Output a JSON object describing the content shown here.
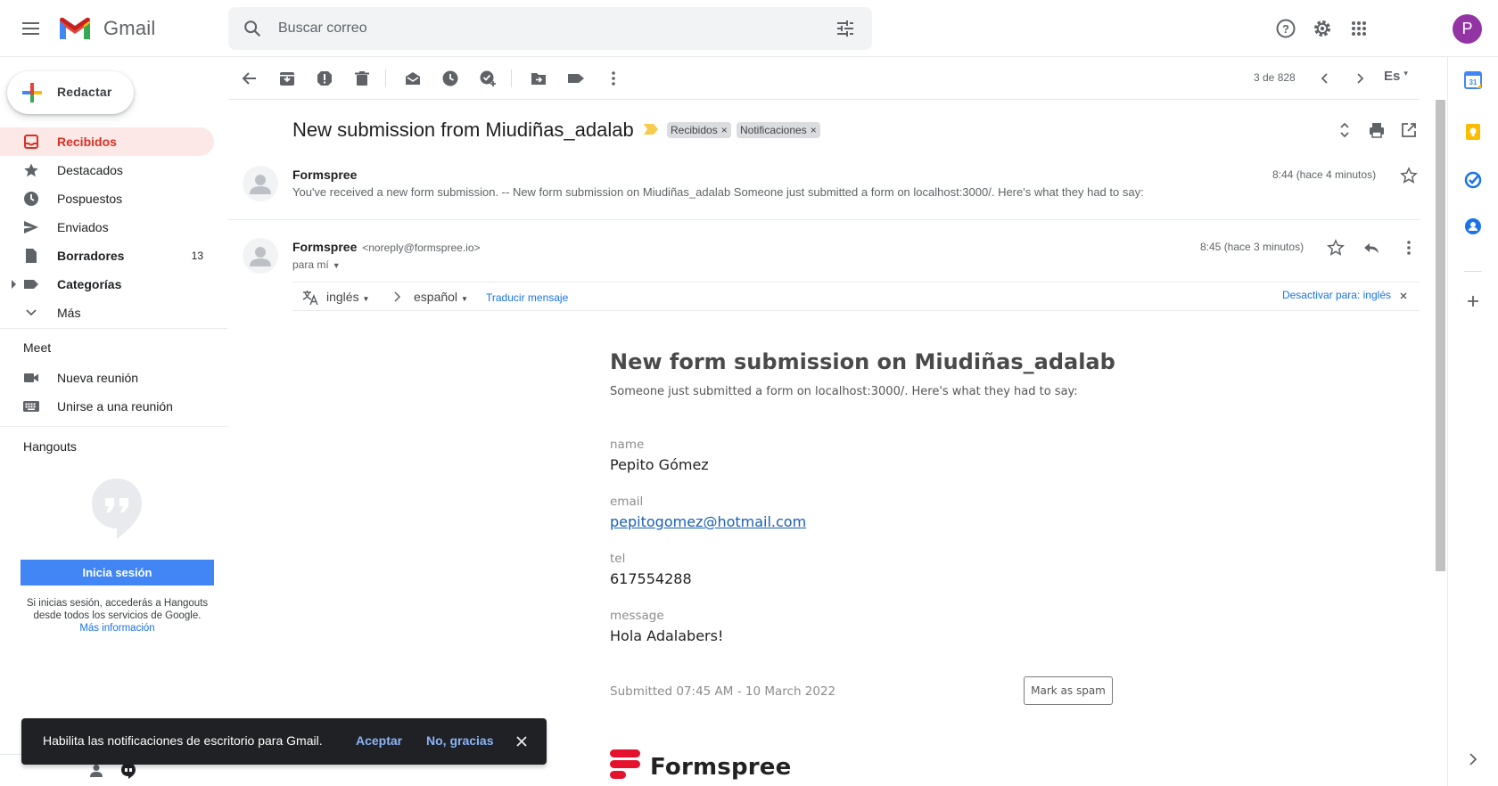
{
  "header": {
    "app_name": "Gmail",
    "search_placeholder": "Buscar correo",
    "avatar_letter": "P",
    "icons": [
      "menu-icon",
      "gmail-logo",
      "search-icon",
      "tune-icon",
      "help-icon",
      "gear-icon",
      "apps-icon"
    ]
  },
  "compose": {
    "label": "Redactar"
  },
  "nav": {
    "items": [
      {
        "label": "Recibidos",
        "icon": "inbox-icon",
        "count": "",
        "active": true
      },
      {
        "label": "Destacados",
        "icon": "star-icon",
        "count": ""
      },
      {
        "label": "Pospuestos",
        "icon": "clock-icon",
        "count": ""
      },
      {
        "label": "Enviados",
        "icon": "send-icon",
        "count": ""
      },
      {
        "label": "Borradores",
        "icon": "draft-icon",
        "count": "13",
        "bold": true
      },
      {
        "label": "Categorías",
        "icon": "label-icon",
        "count": "",
        "bold": true
      },
      {
        "label": "Más",
        "icon": "chevron-down-icon",
        "count": ""
      }
    ],
    "meet_title": "Meet",
    "meet_items": [
      {
        "label": "Nueva reunión",
        "icon": "video-icon"
      },
      {
        "label": "Unirse a una reunión",
        "icon": "keyboard-icon"
      }
    ],
    "hangouts_title": "Hangouts",
    "signin_button": "Inicia sesión",
    "signin_note": "Si inicias sesión, accederás a Hangouts desde todos los servicios de Google.",
    "signin_more": "Más información"
  },
  "toast": {
    "text": "Habilita las notificaciones de escritorio para Gmail.",
    "accept": "Aceptar",
    "decline": "No, gracias"
  },
  "toolbar": {
    "pager": "3 de 828",
    "language": "Es",
    "icons": [
      "back-arrow-icon",
      "archive-icon",
      "report-spam-icon",
      "delete-icon",
      "mark-unread-icon",
      "snooze-icon",
      "add-task-icon",
      "move-to-icon",
      "label-icon",
      "more-vert-icon"
    ]
  },
  "thread": {
    "subject": "New submission from Miudiñas_adalab",
    "labels": [
      "Recibidos",
      "Notificaciones"
    ],
    "label_remove": "×",
    "messages": [
      {
        "sender": "Formspree",
        "snippet": "You've received a new form submission. -- New form submission on Miudiñas_adalab Someone just submitted a form on localhost:3000/. Here's what they had to say:",
        "time": "8:44 (hace 4 minutos)"
      },
      {
        "sender": "Formspree",
        "sender_email": "<noreply@formspree.io>",
        "to": "para mí",
        "time": "8:45 (hace 3 minutos)"
      }
    ]
  },
  "translate": {
    "from": "inglés",
    "to": "español",
    "link": "Traducir mensaje",
    "disable": "Desactivar para: inglés"
  },
  "email_body": {
    "title": "New form submission on Miudiñas_adalab",
    "subtitle": "Someone just submitted a form on localhost:3000/. Here's what they had to say:",
    "fields": [
      {
        "key": "name",
        "value": "Pepito Gómez"
      },
      {
        "key": "email",
        "value": "pepitogomez@hotmail.com"
      },
      {
        "key": "tel",
        "value": "617554288"
      },
      {
        "key": "message",
        "value": "Hola Adalabers!"
      }
    ],
    "submitted": "Submitted 07:45 AM - 10 March 2022",
    "spam_button": "Mark as spam",
    "brand": "Formspree",
    "brand_color": "#e5122e"
  },
  "side_panel": {
    "icons": [
      "calendar-icon",
      "keep-icon",
      "tasks-icon",
      "contacts-icon",
      "add-icon",
      "chevron-right-icon"
    ],
    "calendar_day": "31"
  },
  "colors": {
    "accent_red": "#d93025",
    "active_bg": "#fce8e6",
    "link_blue": "#1a73e8",
    "signin_blue": "#4285f4"
  }
}
